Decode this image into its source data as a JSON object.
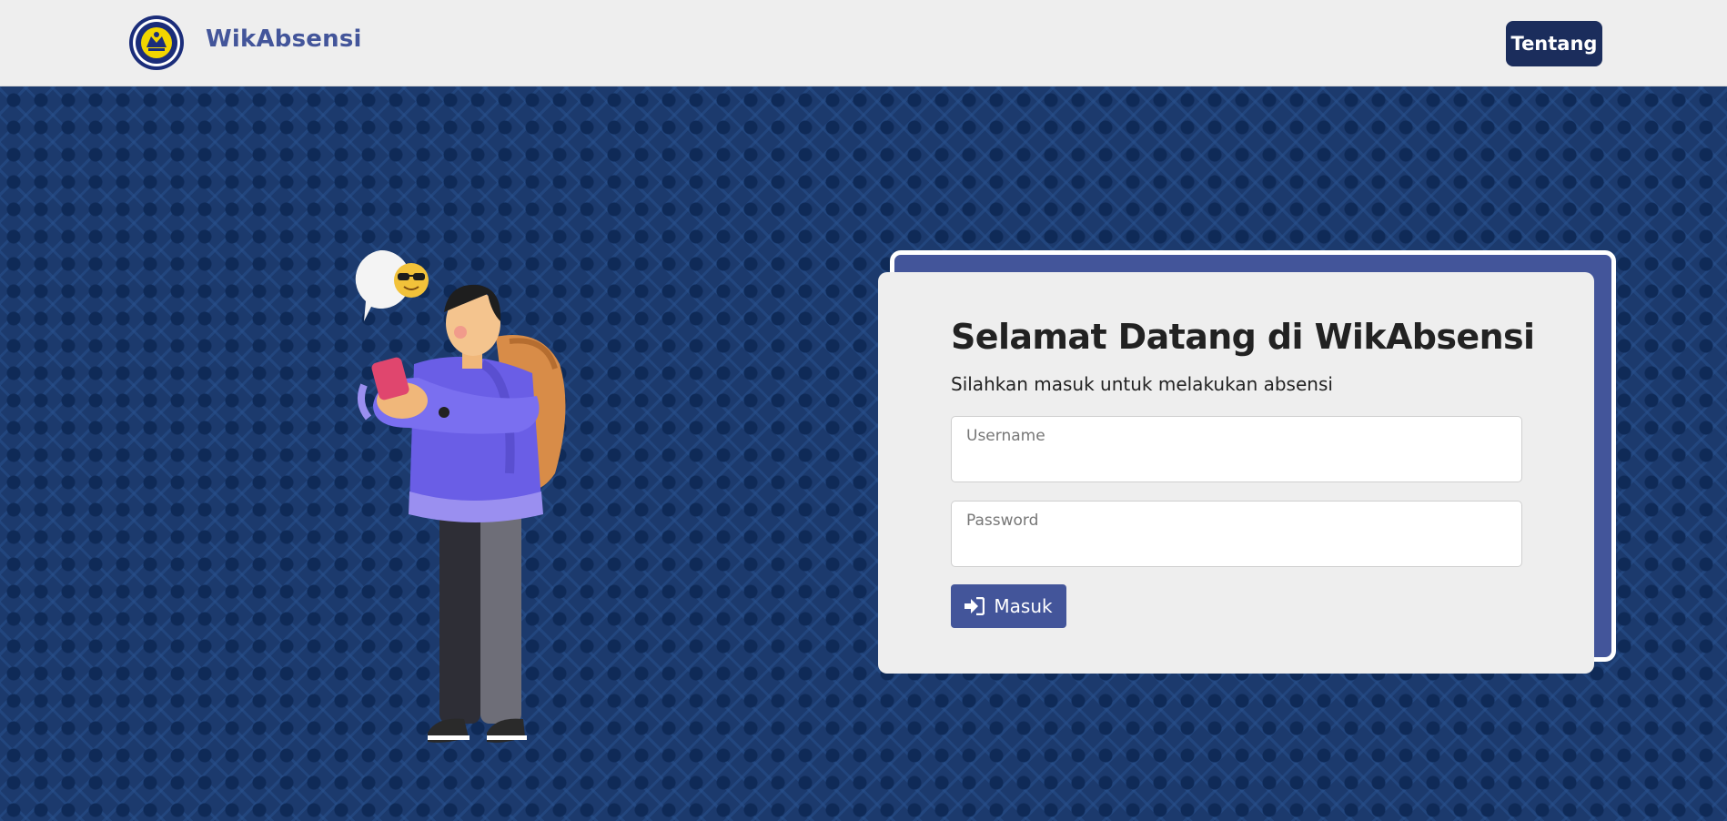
{
  "navbar": {
    "brand_name": "WikAbsensi",
    "about_label": "Tentang",
    "logo_icon": "school-emblem-icon"
  },
  "login": {
    "title": "Selamat Datang di WikAbsensi",
    "subtitle": "Silahkan masuk untuk melakukan absensi",
    "username_label": "Username",
    "password_label": "Password",
    "submit_label": "Masuk",
    "submit_icon": "sign-in-icon"
  },
  "illustration": {
    "icon": "person-with-phone-illustration",
    "bubble_icon": "sunglasses-emoji-icon"
  },
  "colors": {
    "brand": "#43559a",
    "nav_button": "#1b2d5c",
    "background": "#1c3a6d",
    "card": "#eeeeee"
  }
}
